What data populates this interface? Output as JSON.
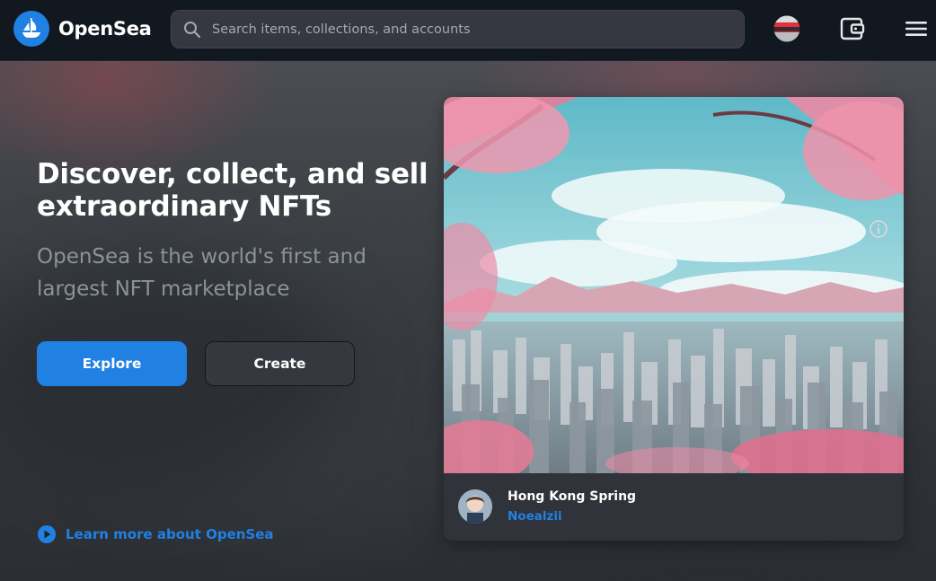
{
  "header": {
    "brand": "OpenSea",
    "search_placeholder": "Search items, collections, and accounts",
    "icons": [
      "opensea-logo-icon",
      "search-icon",
      "profile-avatar",
      "wallet-icon",
      "menu-icon"
    ]
  },
  "hero": {
    "title": "Discover, collect, and sell extraordinary NFTs",
    "subtitle": "OpenSea is the world's first and largest NFT marketplace",
    "explore_label": "Explore",
    "create_label": "Create",
    "learn_more_label": "Learn more about OpenSea"
  },
  "featured": {
    "item_name": "Hong Kong Spring",
    "creator": "Noealzii"
  },
  "colors": {
    "accent": "#2081e2",
    "header_bg": "#111820",
    "card_bg": "#303339",
    "subtitle_text": "#8a939b"
  }
}
